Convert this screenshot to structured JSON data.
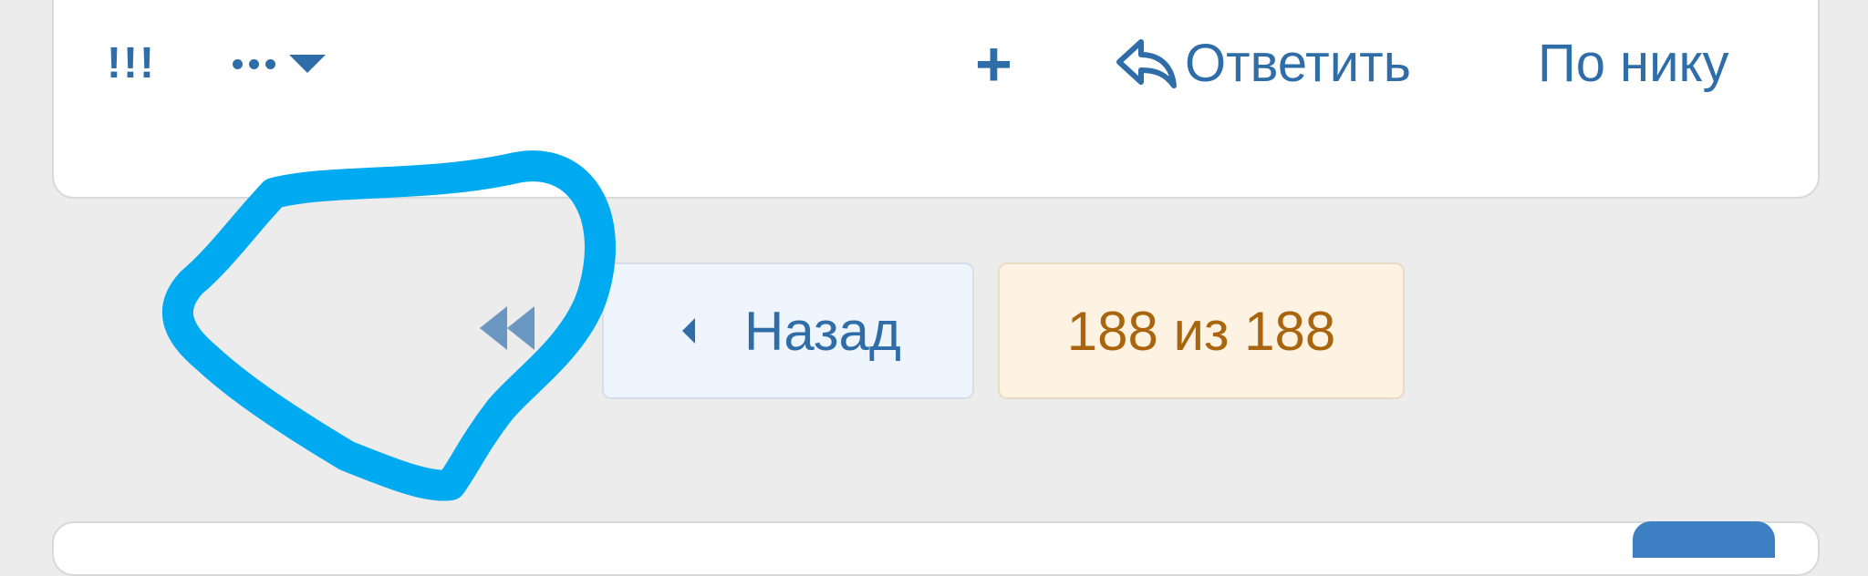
{
  "post_actions": {
    "exclamation_label": "!!!",
    "more_icon": "ellipsis-dropdown-icon",
    "plus_label": "+",
    "reply_icon": "reply-arrow-icon",
    "reply_label": "Ответить",
    "by_nick_label": "По нику"
  },
  "pagination": {
    "first_icon": "double-left-arrow-icon",
    "prev_label": "Назад",
    "page_indicator": "188 из 188"
  },
  "annotation": {
    "color": "#00aaf0"
  },
  "colors": {
    "link": "#2f6da8",
    "prev_bg": "#eef5fd",
    "page_bg": "#fef2e3",
    "page_text": "#a9650e",
    "background": "#ececec"
  }
}
